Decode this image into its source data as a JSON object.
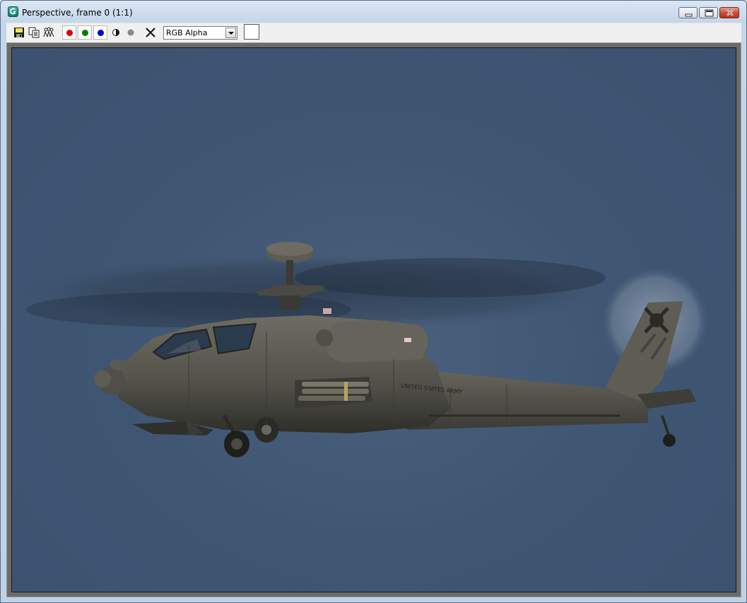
{
  "window": {
    "title": "Perspective, frame 0 (1:1)",
    "title_bar_buttons": [
      "minimize-icon",
      "restore-icon",
      "close-icon"
    ]
  },
  "toolbar": {
    "tools": [
      "save-icon",
      "clone-icon",
      "copy-icon",
      "red-channel",
      "green-channel",
      "blue-channel",
      "mono-icon",
      "alpha-channel-icon",
      "clear-icon"
    ],
    "channel_colors": {
      "red": "#e00000",
      "green": "#008000",
      "blue": "#0000e0"
    },
    "display_select": {
      "selected": "RGB Alpha"
    }
  },
  "render": {
    "background_color": "#3f5673",
    "tail_text": "UNITED STATES ARMY"
  }
}
